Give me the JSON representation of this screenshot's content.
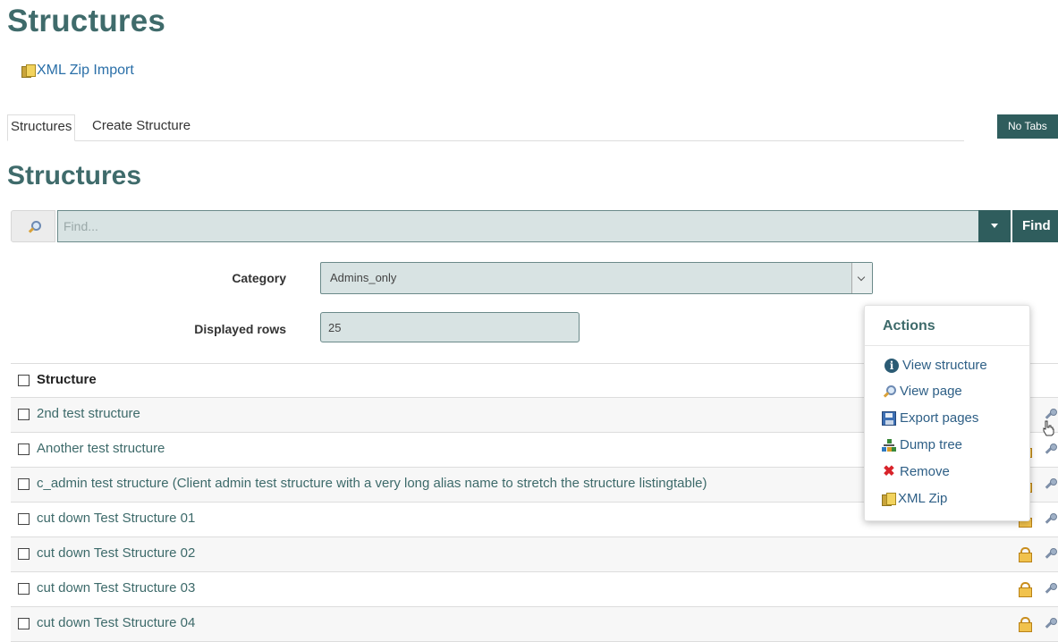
{
  "page": {
    "title": "Structures",
    "section_title": "Structures"
  },
  "toolbar": {
    "xml_zip_import_label": "XML Zip Import"
  },
  "tabs": [
    {
      "label": "Structures",
      "active": true
    },
    {
      "label": "Create Structure",
      "active": false
    }
  ],
  "no_tabs_label": "No Tabs",
  "search": {
    "placeholder": "Find...",
    "value": "",
    "find_label": "Find"
  },
  "filters": {
    "category_label": "Category",
    "category_value": "Admins_only",
    "rows_label": "Displayed rows",
    "rows_value": "25"
  },
  "table": {
    "header": "Structure",
    "rows": [
      "2nd test structure",
      "Another test structure",
      "c_admin test structure (Client admin test structure with a very long alias name to stretch the structure listingtable)",
      "cut down Test Structure 01",
      "cut down Test Structure 02",
      "cut down Test Structure 03",
      "cut down Test Structure 04"
    ]
  },
  "actions_popup": {
    "title": "Actions",
    "items": [
      {
        "label": "View structure",
        "icon": "info-icon"
      },
      {
        "label": "View page",
        "icon": "magnifier-icon"
      },
      {
        "label": "Export pages",
        "icon": "save-icon"
      },
      {
        "label": "Dump tree",
        "icon": "tree-icon"
      },
      {
        "label": "Remove",
        "icon": "remove-icon"
      },
      {
        "label": "XML Zip",
        "icon": "zip-icon"
      }
    ]
  },
  "colors": {
    "accent": "#2f5d5d",
    "title": "#3f6b6b",
    "link": "#2a6fa8"
  }
}
